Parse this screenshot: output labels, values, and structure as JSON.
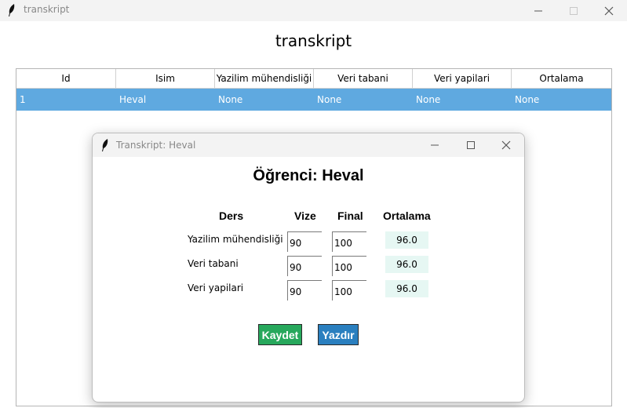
{
  "window": {
    "title": "transkript"
  },
  "heading": "transkript",
  "table": {
    "columns": [
      "Id",
      "Isim",
      "Yazilim mühendisliği",
      "Veri tabani",
      "Veri yapilari",
      "Ortalama"
    ],
    "rows": [
      [
        "1",
        "Heval",
        "None",
        "None",
        "None",
        "None"
      ]
    ]
  },
  "dialog": {
    "title": "Transkript: Heval",
    "heading": "Öğrenci: Heval",
    "columns": {
      "course": "Ders",
      "vize": "Vize",
      "final": "Final",
      "avg": "Ortalama"
    },
    "rows": [
      {
        "course": "Yazilim mühendisliği",
        "vize": "90",
        "final": "100",
        "avg": "96.0"
      },
      {
        "course": "Veri tabani",
        "vize": "90",
        "final": "100",
        "avg": "96.0"
      },
      {
        "course": "Veri yapilari",
        "vize": "90",
        "final": "100",
        "avg": "96.0"
      }
    ],
    "save_label": "Kaydet",
    "print_label": "Yazdır",
    "colors": {
      "save": "#27a85c",
      "print": "#2a7fbf",
      "avg_bg": "#e6f7f3",
      "selected_row": "#5fa9e0"
    }
  }
}
